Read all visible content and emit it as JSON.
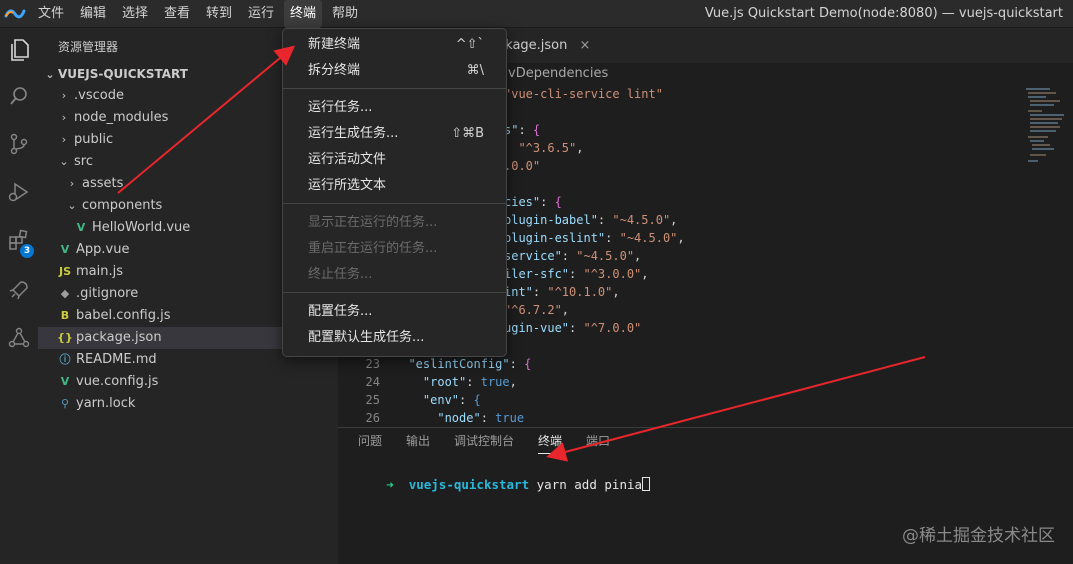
{
  "menubar": {
    "items": [
      "文件",
      "编辑",
      "选择",
      "查看",
      "转到",
      "运行",
      "终端",
      "帮助"
    ],
    "window_title": "Vue.js Quickstart Demo(node:8080) — vuejs-quickstart"
  },
  "activity": {
    "extensions_badge": "3"
  },
  "sidebar": {
    "title": "资源管理器",
    "root": "VUEJS-QUICKSTART",
    "tree": [
      {
        "label": ".vscode",
        "chevron": "›",
        "icon": ""
      },
      {
        "label": "node_modules",
        "chevron": "›",
        "icon": ""
      },
      {
        "label": "public",
        "chevron": "›",
        "icon": ""
      },
      {
        "label": "src",
        "chevron": "⌄",
        "icon": ""
      },
      {
        "label": "assets",
        "chevron": "›",
        "icon": ""
      },
      {
        "label": "components",
        "chevron": "⌄",
        "icon": ""
      },
      {
        "label": "HelloWorld.vue",
        "chevron": "",
        "icon": "V"
      },
      {
        "label": "App.vue",
        "chevron": "",
        "icon": "V"
      },
      {
        "label": "main.js",
        "chevron": "",
        "icon": "JS"
      },
      {
        "label": ".gitignore",
        "chevron": "",
        "icon": "◆"
      },
      {
        "label": "babel.config.js",
        "chevron": "",
        "icon": "B"
      },
      {
        "label": "package.json",
        "chevron": "",
        "icon": "{}"
      },
      {
        "label": "README.md",
        "chevron": "",
        "icon": "ⓘ"
      },
      {
        "label": "vue.config.js",
        "chevron": "",
        "icon": "V"
      },
      {
        "label": "yarn.lock",
        "chevron": "",
        "icon": "⚲"
      }
    ]
  },
  "editor": {
    "tab_label": "ckage.json",
    "tab_close": "×",
    "breadcrumb": "vDependencies",
    "lines": [
      {
        "n": "",
        "parts": [
          [
            "s",
            "\"vue-cli-service lint\""
          ]
        ]
      },
      {
        "n": "",
        "parts": []
      },
      {
        "n": "",
        "parts": [
          [
            "k",
            "s\""
          ],
          [
            "p",
            ": "
          ],
          [
            "br",
            "{"
          ]
        ]
      },
      {
        "n": "",
        "parts": [
          [
            "p",
            "  "
          ],
          [
            "s",
            "\"^3.6.5\""
          ],
          [
            "p",
            ","
          ]
        ]
      },
      {
        "n": "",
        "parts": [
          [
            "s",
            ".0.0\""
          ]
        ]
      },
      {
        "n": "",
        "parts": []
      },
      {
        "n": "",
        "parts": [
          [
            "k",
            "cies\""
          ],
          [
            "p",
            ": "
          ],
          [
            "br",
            "{"
          ]
        ]
      },
      {
        "n": "",
        "parts": [
          [
            "k",
            "plugin-babel\""
          ],
          [
            "p",
            ": "
          ],
          [
            "s",
            "\"~4.5.0\""
          ],
          [
            "p",
            ","
          ]
        ]
      },
      {
        "n": "",
        "parts": [
          [
            "k",
            "plugin-eslint\""
          ],
          [
            "p",
            ": "
          ],
          [
            "s",
            "\"~4.5.0\""
          ],
          [
            "p",
            ","
          ]
        ]
      },
      {
        "n": "",
        "parts": [
          [
            "k",
            "service\""
          ],
          [
            "p",
            ": "
          ],
          [
            "s",
            "\"~4.5.0\""
          ],
          [
            "p",
            ","
          ]
        ]
      },
      {
        "n": "",
        "parts": [
          [
            "k",
            "iler-sfc\""
          ],
          [
            "p",
            ": "
          ],
          [
            "s",
            "\"^3.0.0\""
          ],
          [
            "p",
            ","
          ]
        ]
      },
      {
        "n": "",
        "parts": [
          [
            "k",
            "int\""
          ],
          [
            "p",
            ": "
          ],
          [
            "s",
            "\"^10.1.0\""
          ],
          [
            "p",
            ","
          ]
        ]
      },
      {
        "n": "",
        "parts": [
          [
            "s",
            "\"^6.7.2\""
          ],
          [
            "p",
            ","
          ]
        ]
      },
      {
        "n": "",
        "parts": [
          [
            "k",
            "ugin-vue\""
          ],
          [
            "p",
            ": "
          ],
          [
            "s",
            "\"^7.0.0\""
          ]
        ]
      },
      {
        "n": "",
        "parts": []
      },
      {
        "n": "23",
        "parts": [
          [
            "p",
            "  "
          ],
          [
            "k",
            "\"eslintConfig\""
          ],
          [
            "p",
            ": "
          ],
          [
            "br",
            "{"
          ]
        ]
      },
      {
        "n": "24",
        "parts": [
          [
            "p",
            "    "
          ],
          [
            "k",
            "\"root\""
          ],
          [
            "p",
            ": "
          ],
          [
            "b",
            "true"
          ],
          [
            "p",
            ","
          ]
        ]
      },
      {
        "n": "25",
        "parts": [
          [
            "p",
            "    "
          ],
          [
            "k",
            "\"env\""
          ],
          [
            "p",
            ": "
          ],
          [
            "b",
            "{"
          ]
        ]
      },
      {
        "n": "26",
        "parts": [
          [
            "p",
            "      "
          ],
          [
            "k",
            "\"node\""
          ],
          [
            "p",
            ": "
          ],
          [
            "b",
            "true"
          ]
        ]
      }
    ]
  },
  "panel": {
    "tabs": [
      "问题",
      "输出",
      "调试控制台",
      "终端",
      "端口"
    ],
    "active_tab": "终端",
    "prompt_arrow": "➜",
    "prompt_dir": "vuejs-quickstart",
    "command": "yarn add pinia"
  },
  "menu": {
    "items": [
      {
        "label": "新建终端",
        "shortcut": "^⇧`",
        "disabled": false
      },
      {
        "label": "拆分终端",
        "shortcut": "⌘\\",
        "disabled": false
      },
      {
        "label": "运行任务...",
        "shortcut": "",
        "disabled": false
      },
      {
        "label": "运行生成任务...",
        "shortcut": "⇧⌘B",
        "disabled": false
      },
      {
        "label": "运行活动文件",
        "shortcut": "",
        "disabled": false
      },
      {
        "label": "运行所选文本",
        "shortcut": "",
        "disabled": false
      },
      {
        "label": "显示正在运行的任务...",
        "shortcut": "",
        "disabled": true
      },
      {
        "label": "重启正在运行的任务...",
        "shortcut": "",
        "disabled": true
      },
      {
        "label": "终止任务...",
        "shortcut": "",
        "disabled": true
      },
      {
        "label": "配置任务...",
        "shortcut": "",
        "disabled": false
      },
      {
        "label": "配置默认生成任务...",
        "shortcut": "",
        "disabled": false
      }
    ]
  },
  "watermark": "@稀土掘金技术社区",
  "colors": {
    "annotation_arrow": "#e8262b",
    "folder_green": "#89d185",
    "vue_green": "#41b883",
    "js_yellow": "#cbcb41"
  }
}
